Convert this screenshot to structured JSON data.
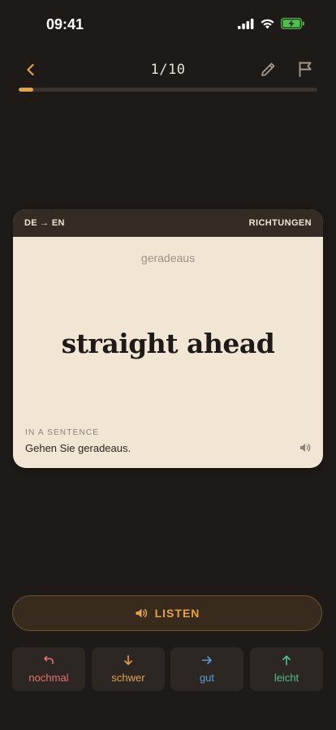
{
  "status_bar": {
    "time": "09:41"
  },
  "nav": {
    "progress": "1/10",
    "progress_fraction": 0.05
  },
  "card": {
    "direction": "DE → EN",
    "deck": "RICHTUNGEN",
    "prompt": "geradeaus",
    "answer": "straight ahead",
    "sentence_label": "IN A SENTENCE",
    "sentence": "Gehen Sie geradeaus."
  },
  "listen": {
    "label": "LISTEN"
  },
  "ratings": [
    {
      "label": "nochmal",
      "color": "#e5736e",
      "icon": "undo-icon"
    },
    {
      "label": "schwer",
      "color": "#e3a24a",
      "icon": "arrow-down-icon"
    },
    {
      "label": "gut",
      "color": "#5b9bd8",
      "icon": "arrow-right-icon"
    },
    {
      "label": "leicht",
      "color": "#4fc08a",
      "icon": "arrow-up-icon"
    }
  ],
  "colors": {
    "accent": "#e3a24a",
    "background": "#1e1a17",
    "card": "#f1e6d3"
  }
}
